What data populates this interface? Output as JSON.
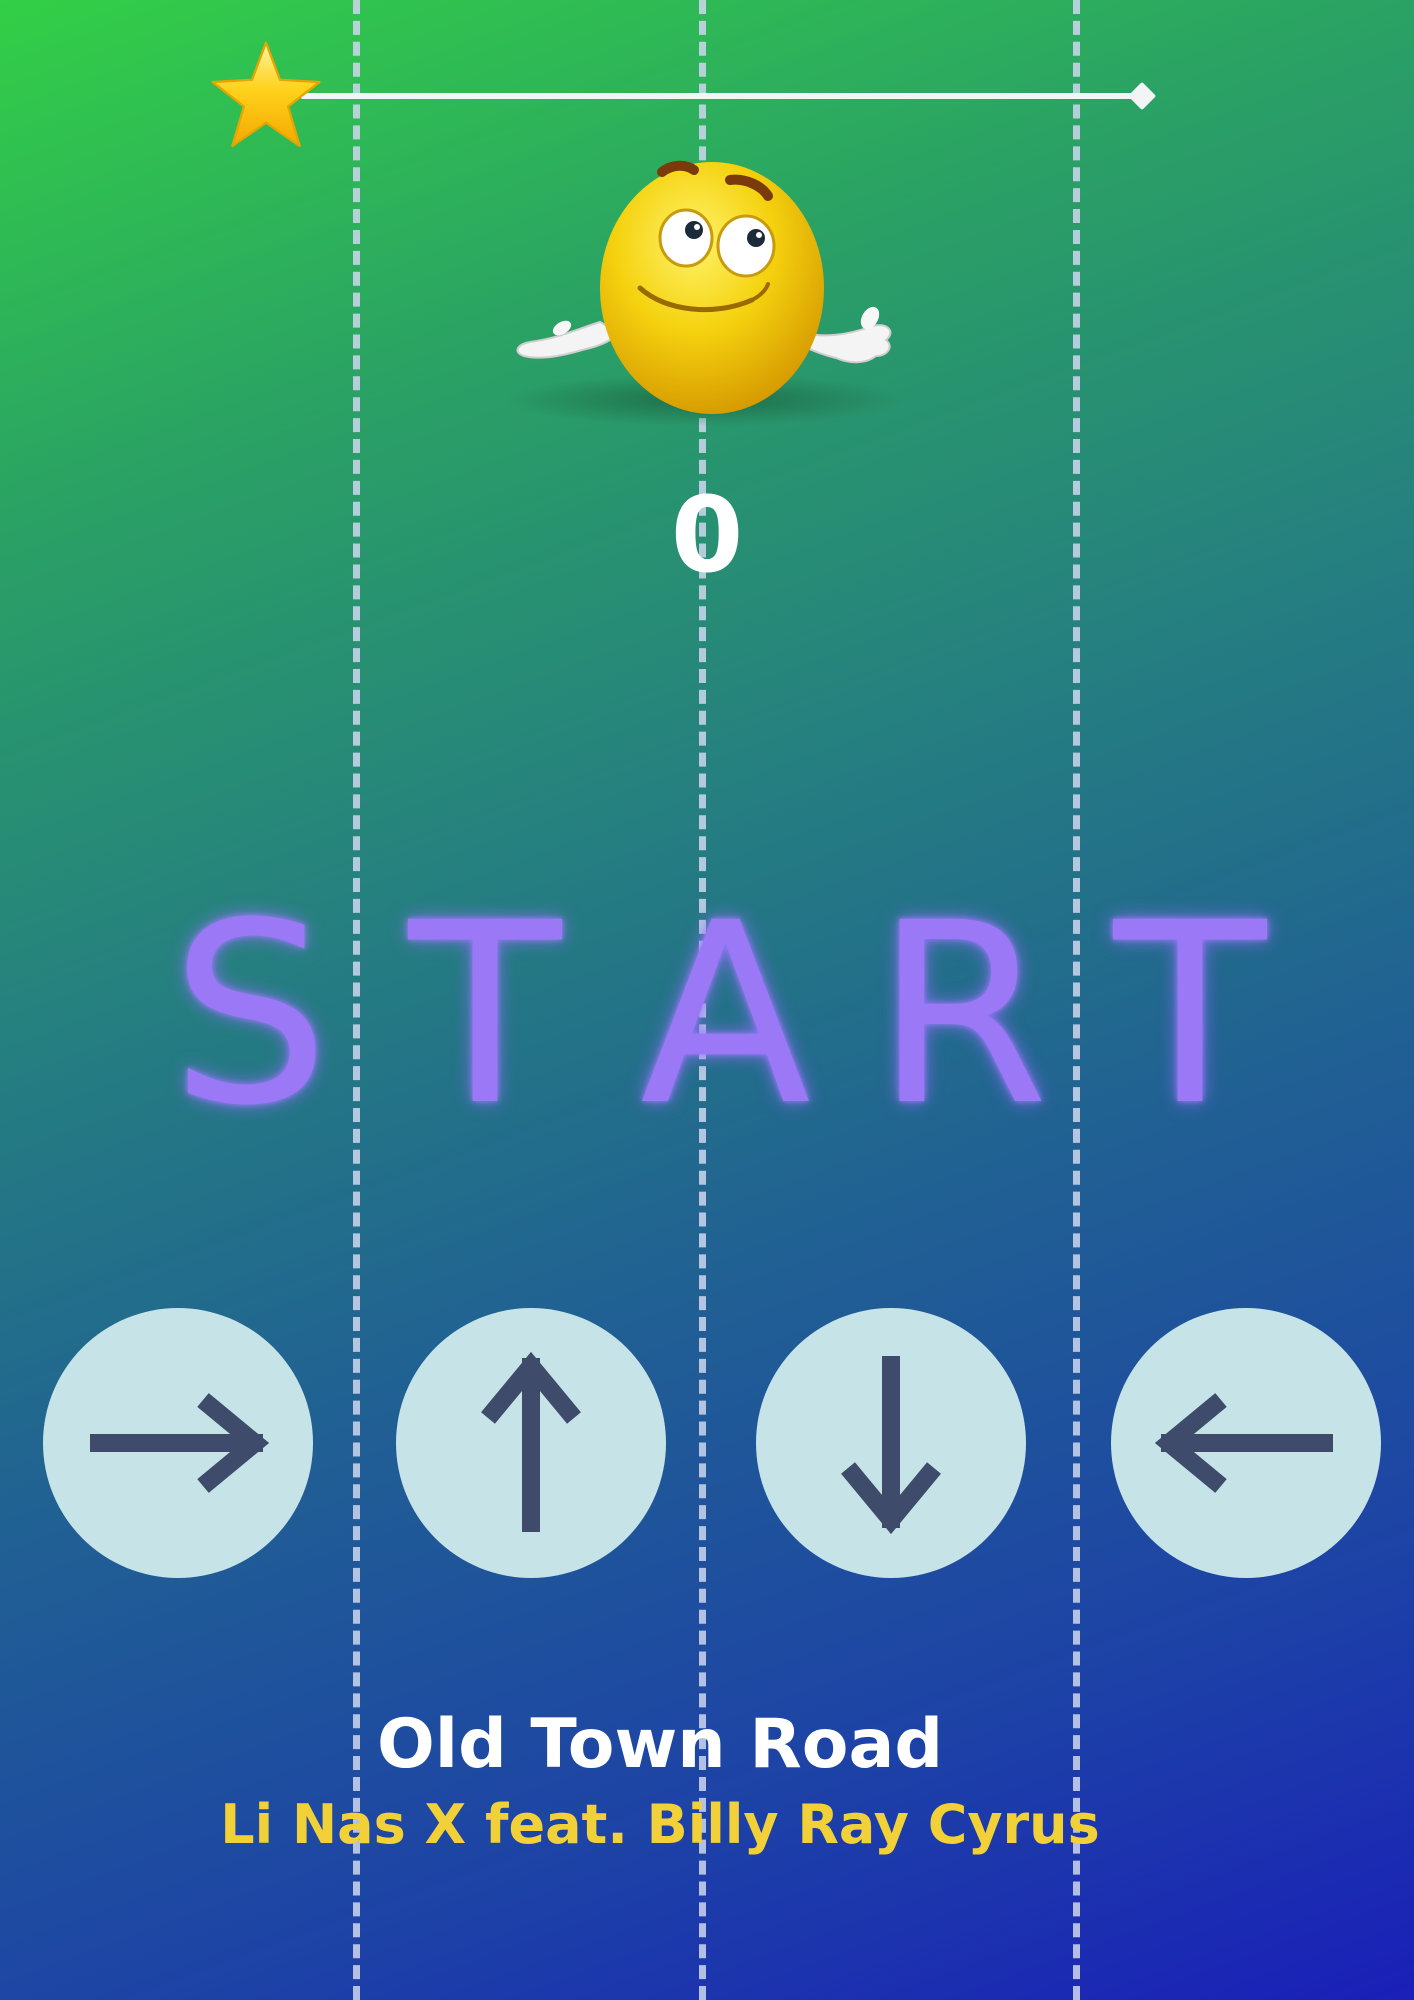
{
  "progress": {
    "fraction": 0,
    "star_icon": "star-icon",
    "end_marker_icon": "diamond-icon"
  },
  "character": {
    "icon": "shrugging-emoji-character"
  },
  "score": "0",
  "start": {
    "letters": [
      "S",
      "T",
      "A",
      "R",
      "T"
    ],
    "color": "#9b78f5"
  },
  "arrows": [
    {
      "direction": "right",
      "glyph": "right-arrow-icon"
    },
    {
      "direction": "up",
      "glyph": "up-arrow-icon"
    },
    {
      "direction": "down",
      "glyph": "down-arrow-icon"
    },
    {
      "direction": "left",
      "glyph": "left-arrow-icon"
    }
  ],
  "song": {
    "title": "Old Town Road",
    "artist": "Li Nas X feat. Billy Ray Cyrus"
  },
  "colors": {
    "button_fill": "#c6e3e7",
    "arrow_color": "#3e4b6a",
    "artist_color": "#f2d038",
    "lane_line": "#ced7ee"
  }
}
